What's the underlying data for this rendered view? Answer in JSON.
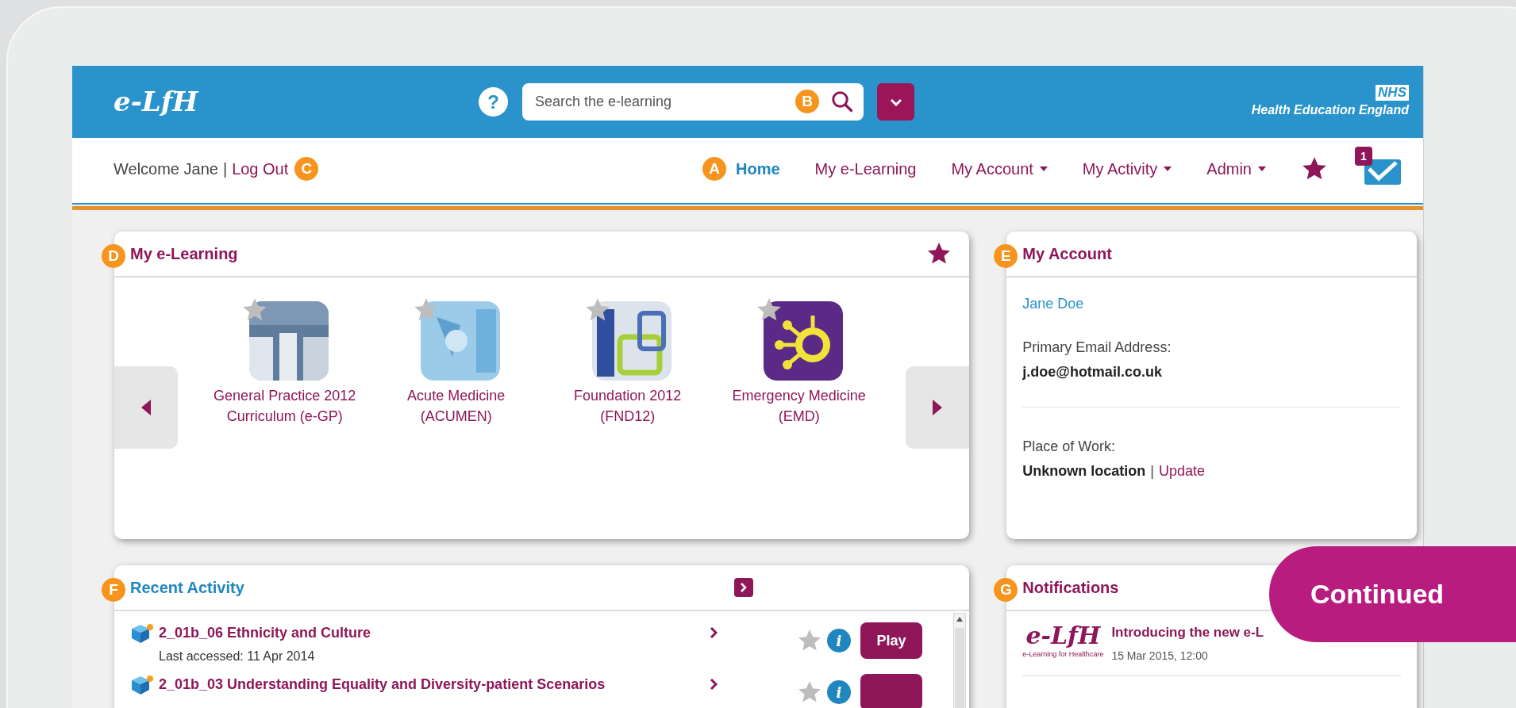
{
  "header": {
    "logo": "e-LfH",
    "help": "?",
    "search": {
      "placeholder": "Search the e-learning",
      "marker": "B"
    },
    "org": {
      "badge": "NHS",
      "name": "Health Education England"
    }
  },
  "nav": {
    "welcome": "Welcome Jane",
    "separator": "|",
    "logout": "Log Out",
    "marker": "C",
    "home_marker": "A",
    "items": [
      {
        "label": "Home",
        "selected": true,
        "menu": false
      },
      {
        "label": "My e-Learning",
        "selected": false,
        "menu": false
      },
      {
        "label": "My Account",
        "selected": false,
        "menu": true
      },
      {
        "label": "My Activity",
        "selected": false,
        "menu": true
      },
      {
        "label": "Admin",
        "selected": false,
        "menu": true
      }
    ],
    "message_count": "1"
  },
  "my_elearning": {
    "marker": "D",
    "title": "My e-Learning",
    "courses": [
      {
        "lines": [
          "General Practice 2012",
          "Curriculum (e-GP)"
        ],
        "favorite": false
      },
      {
        "lines": [
          "Acute Medicine",
          "(ACUMEN)"
        ],
        "favorite": false
      },
      {
        "lines": [
          "Foundation 2012",
          "(FND12)"
        ],
        "favorite": false
      },
      {
        "lines": [
          "Emergency Medicine",
          "(EMD)"
        ],
        "favorite": false
      }
    ]
  },
  "my_account": {
    "marker": "E",
    "title": "My Account",
    "name": "Jane Doe",
    "email_label": "Primary Email Address:",
    "email": "j.doe@hotmail.co.uk",
    "work_label": "Place of Work:",
    "work": "Unknown location",
    "separator": "|",
    "update": "Update"
  },
  "recent_activity": {
    "marker": "F",
    "title": "Recent Activity",
    "items": [
      {
        "title": "2_01b_06 Ethnicity and Culture",
        "accessed": "Last accessed: 11 Apr 2014",
        "favorite": false,
        "info": "i",
        "action": "Play"
      },
      {
        "title": "2_01b_03 Understanding Equality and Diversity-patient Scenarios",
        "favorite": false,
        "info": "i"
      }
    ]
  },
  "notifications": {
    "marker": "G",
    "title": "Notifications",
    "items": [
      {
        "logo": "e-LfH",
        "logo_caption": "e-Learning for Healthcare",
        "title": "Introducing the new e-L",
        "date": "15 Mar 2015, 12:00"
      }
    ]
  },
  "overlay": {
    "label": "Continued"
  }
}
